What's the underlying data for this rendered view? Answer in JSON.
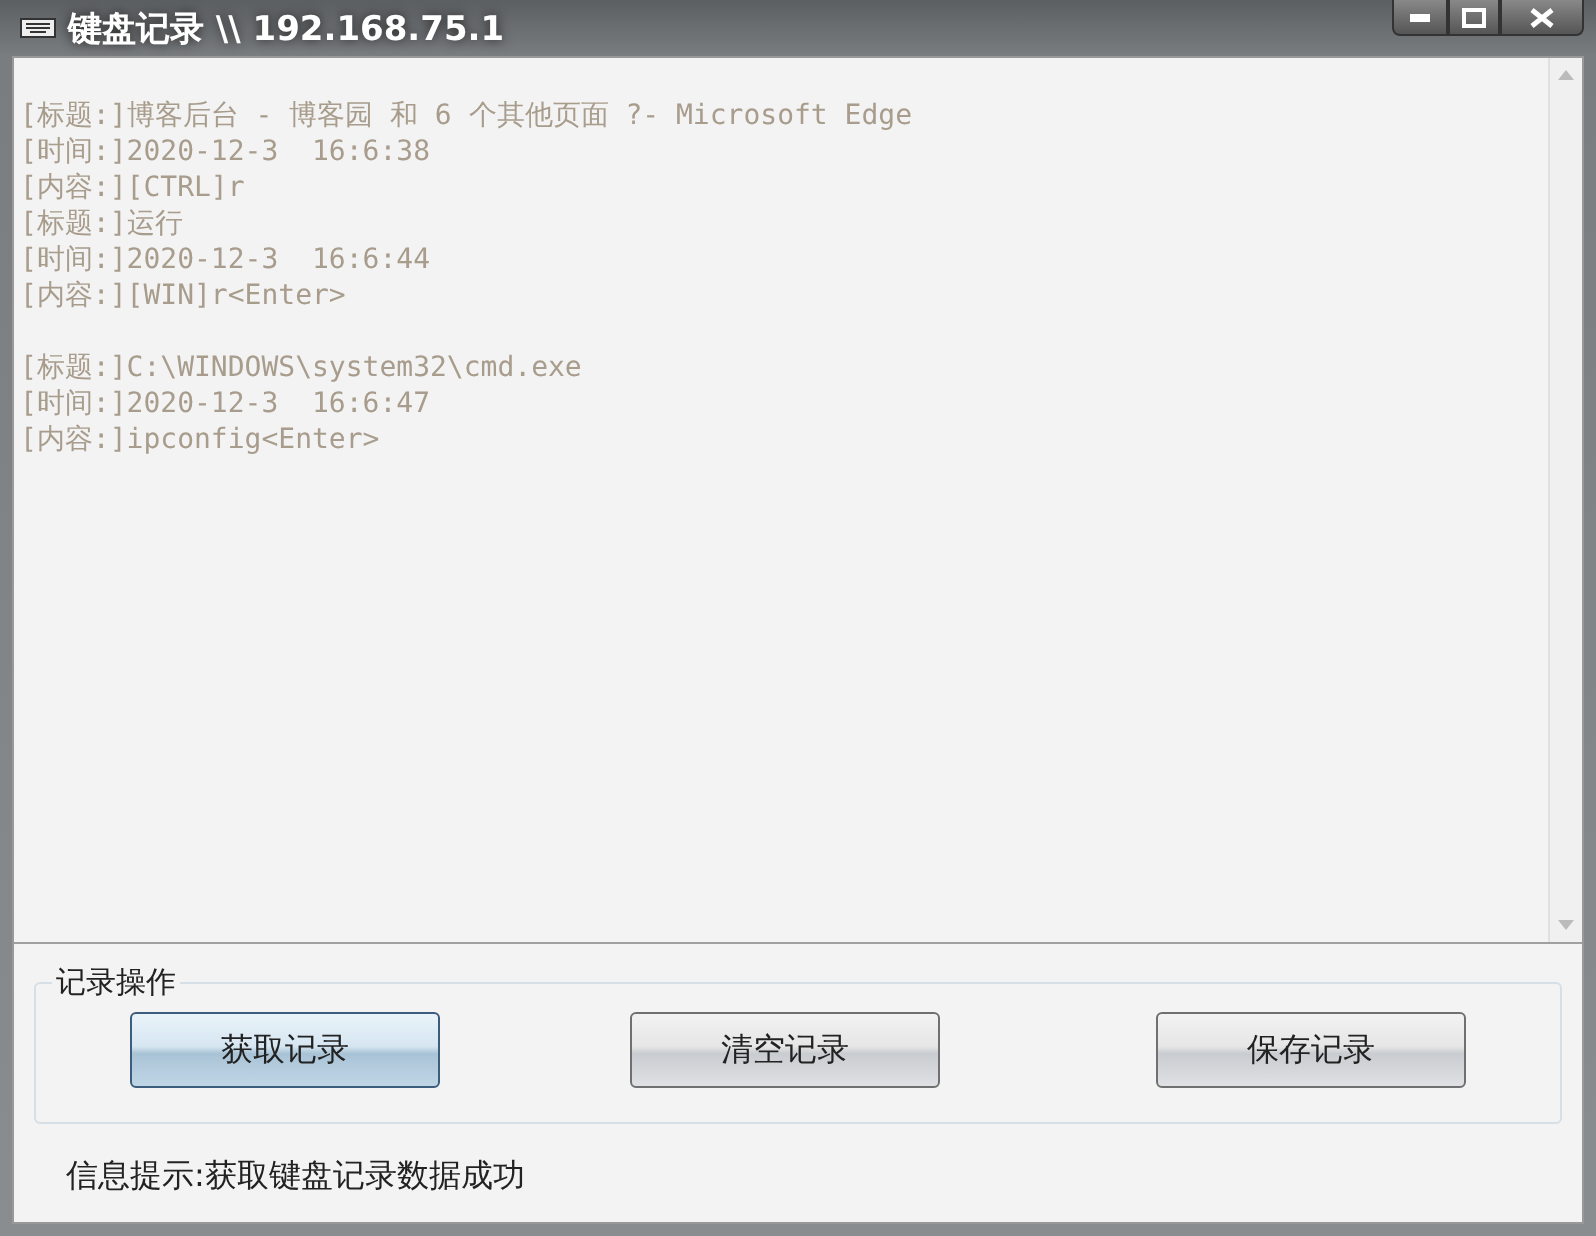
{
  "window": {
    "title": "键盘记录 \\\\ 192.168.75.1"
  },
  "log": {
    "groups": [
      {
        "lines": [
          "[标题:]博客后台 - 博客园 和 6 个其他页面 ?- Microsoft Edge",
          "[时间:]2020-12-3  16:6:38",
          "[内容:][CTRL]r",
          "[标题:]运行",
          "[时间:]2020-12-3  16:6:44",
          "[内容:][WIN]r<Enter>"
        ]
      },
      {
        "lines": [
          "[标题:]C:\\WINDOWS\\system32\\cmd.exe",
          "[时间:]2020-12-3  16:6:47",
          "[内容:]ipconfig<Enter>"
        ]
      }
    ]
  },
  "actions": {
    "legend": "记录操作",
    "buttons": [
      {
        "label": "获取记录",
        "focused": true
      },
      {
        "label": "清空记录",
        "focused": false
      },
      {
        "label": "保存记录",
        "focused": false
      }
    ]
  },
  "status": "信息提示:获取键盘记录数据成功"
}
